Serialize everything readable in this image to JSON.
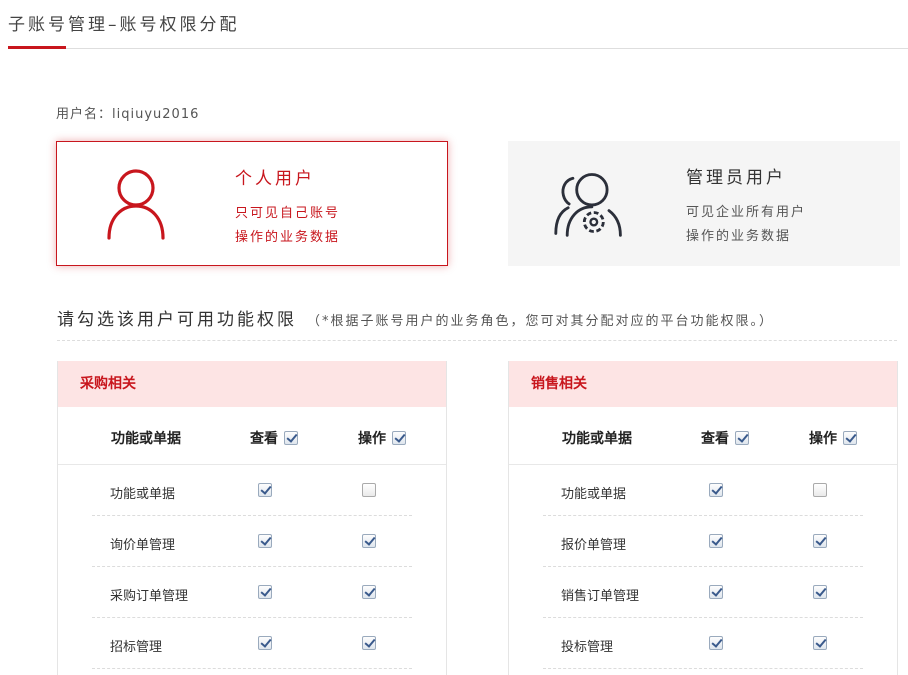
{
  "page": {
    "title": "子账号管理–账号权限分配"
  },
  "user": {
    "label": "用户名：",
    "name": "liqiuyu2016"
  },
  "roles": {
    "personal": {
      "name": "个人用户",
      "desc_line1": "只可见自己账号",
      "desc_line2": "操作的业务数据",
      "icon": "user-icon",
      "selected": true
    },
    "admin": {
      "name": "管理员用户",
      "desc_line1": "可见企业所有用户",
      "desc_line2": "操作的业务数据",
      "icon": "users-gear-icon",
      "selected": false
    }
  },
  "permissions": {
    "heading": "请勾选该用户可用功能权限",
    "note": "（*根据子账号用户的业务角色，您可对其分配对应的平台功能权限。）"
  },
  "panels": {
    "purchase": {
      "title": "采购相关",
      "col_name": "功能或单据",
      "col_view": "查看",
      "col_op": "操作",
      "view_all": true,
      "op_all": true,
      "rows": [
        {
          "name": "功能或单据",
          "view": true,
          "op": false
        },
        {
          "name": "询价单管理",
          "view": true,
          "op": true
        },
        {
          "name": "采购订单管理",
          "view": true,
          "op": true
        },
        {
          "name": "招标管理",
          "view": true,
          "op": true
        }
      ]
    },
    "sales": {
      "title": "销售相关",
      "col_name": "功能或单据",
      "col_view": "查看",
      "col_op": "操作",
      "view_all": true,
      "op_all": true,
      "rows": [
        {
          "name": "功能或单据",
          "view": true,
          "op": false
        },
        {
          "name": "报价单管理",
          "view": true,
          "op": true
        },
        {
          "name": "销售订单管理",
          "view": true,
          "op": true
        },
        {
          "name": "投标管理",
          "view": true,
          "op": true
        }
      ]
    }
  },
  "colors": {
    "accent": "#c8161d",
    "panel_header_bg": "#fde4e4",
    "admin_card_bg": "#f5f5f5"
  }
}
